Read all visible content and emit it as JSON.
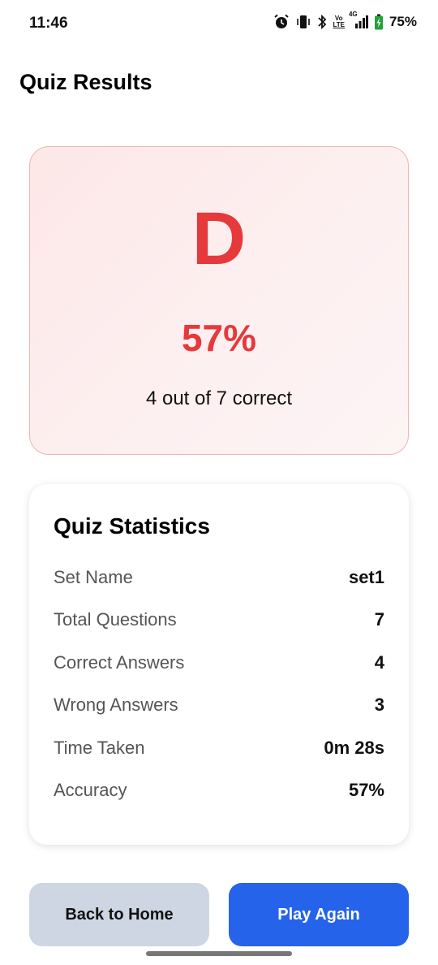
{
  "status_bar": {
    "time": "11:46",
    "battery": "75%",
    "network_top": "Vo",
    "network_bottom": "LTE",
    "signal_label": "4G",
    "icons": [
      "alarm-icon",
      "vibrate-icon",
      "bluetooth-icon",
      "volte-icon",
      "signal-icon",
      "battery-icon"
    ]
  },
  "header": {
    "title": "Quiz Results"
  },
  "result": {
    "grade": "D",
    "percent": "57%",
    "summary": "4 out of 7 correct",
    "accent_color": "#e5393b"
  },
  "stats": {
    "title": "Quiz Statistics",
    "rows": [
      {
        "label": "Set Name",
        "value": "set1"
      },
      {
        "label": "Total Questions",
        "value": "7"
      },
      {
        "label": "Correct Answers",
        "value": "4"
      },
      {
        "label": "Wrong Answers",
        "value": "3"
      },
      {
        "label": "Time Taken",
        "value": "0m 28s"
      },
      {
        "label": "Accuracy",
        "value": "57%"
      }
    ]
  },
  "actions": {
    "back_label": "Back to Home",
    "play_label": "Play Again",
    "primary_color": "#2563eb"
  }
}
